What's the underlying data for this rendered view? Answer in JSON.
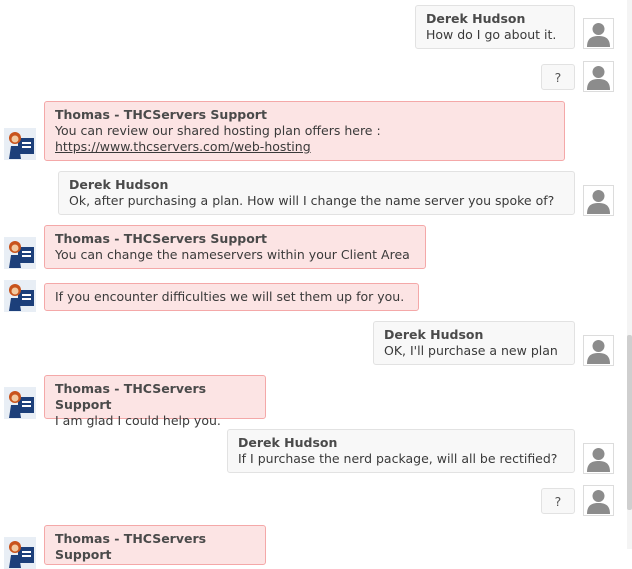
{
  "user_name": "Derek Hudson",
  "agent_name": "Thomas - THCServers Support",
  "messages": [
    {
      "from": "user",
      "text": "How do I go about it."
    },
    {
      "from": "user",
      "text": "?"
    },
    {
      "from": "agent",
      "text": "You can review our shared hosting plan offers here :",
      "link": "https://www.thcservers.com/web-hosting"
    },
    {
      "from": "user",
      "text": "Ok, after purchasing a plan. How will I change the name server you spoke of?"
    },
    {
      "from": "agent",
      "text": "You can change the nameservers within your Client Area"
    },
    {
      "from": "agent",
      "text": "If you encounter difficulties we will set them up for you."
    },
    {
      "from": "user",
      "text": "OK, I'll purchase a new plan"
    },
    {
      "from": "agent",
      "text": "I am glad I could help you."
    },
    {
      "from": "user",
      "text": "If I purchase the nerd package, will all be rectified?"
    },
    {
      "from": "user",
      "text": "?"
    },
    {
      "from": "agent",
      "text": ""
    }
  ],
  "icons": {
    "user_avatar": "person-silhouette-icon",
    "agent_avatar": "support-mascot-icon"
  }
}
